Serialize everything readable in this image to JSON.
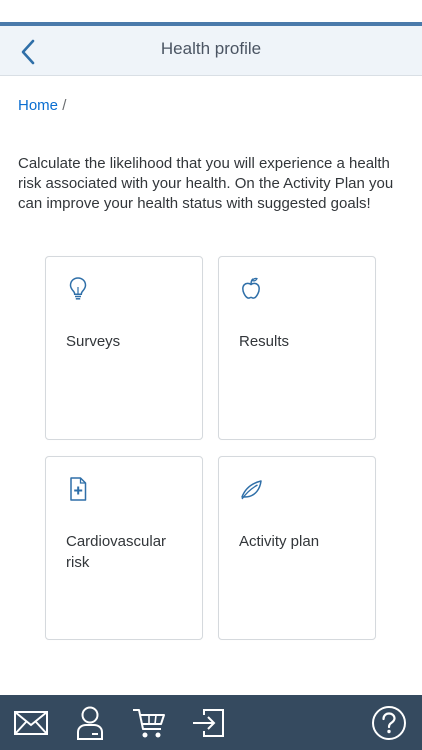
{
  "header": {
    "title": "Health profile",
    "back_icon": "chevron-left-icon"
  },
  "breadcrumb": {
    "home": "Home",
    "separator": "/"
  },
  "intro": {
    "text": "Calculate the likelihood that you will experience a health risk associated with your health. On the Activity Plan you can improve your health status with suggested goals!"
  },
  "tiles": [
    {
      "label": "Surveys",
      "icon": "lightbulb-icon"
    },
    {
      "label": "Results",
      "icon": "apple-icon"
    },
    {
      "label": "Cardiovascular risk",
      "icon": "medical-document-icon"
    },
    {
      "label": "Activity plan",
      "icon": "leaf-icon"
    }
  ],
  "footer": {
    "icons": [
      "mail-icon",
      "user-icon",
      "cart-icon",
      "logout-icon",
      "help-icon"
    ]
  },
  "colors": {
    "accent": "#0a6ed1",
    "header_border": "#4a7aab",
    "header_bg": "#eff4f9",
    "footer_bg": "#354a5f",
    "icon_blue": "#2f6fa8"
  }
}
